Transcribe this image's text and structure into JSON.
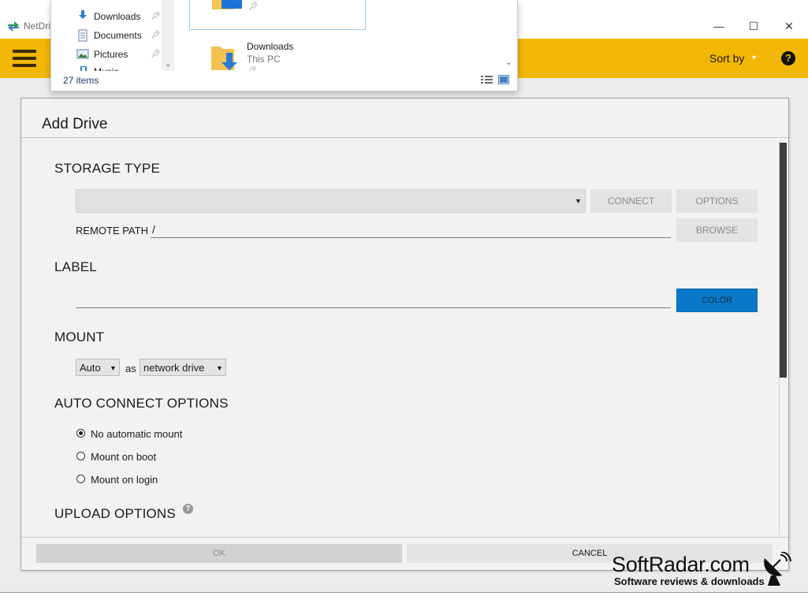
{
  "window": {
    "title": "NetDri",
    "min": "—",
    "max": "☐",
    "close": "✕"
  },
  "toolbar": {
    "sort_label": "Sort by",
    "sort_caret": "▾",
    "help": "?"
  },
  "explorer": {
    "nav_items": [
      {
        "label": "Downloads",
        "icon": "downloads-icon"
      },
      {
        "label": "Documents",
        "icon": "documents-icon"
      },
      {
        "label": "Pictures",
        "icon": "pictures-icon"
      },
      {
        "label": "Music",
        "icon": "music-icon"
      }
    ],
    "files": [
      {
        "name": "Downloads",
        "location": "This PC"
      }
    ],
    "item_count": "27 items"
  },
  "dialog": {
    "title": "Add Drive",
    "storage_type": {
      "heading": "STORAGE TYPE",
      "selected": "",
      "connect": "CONNECT",
      "options": "OPTIONS",
      "remote_path_label": "REMOTE PATH",
      "remote_path_value": "/",
      "browse": "BROWSE"
    },
    "label": {
      "heading": "LABEL",
      "value": "",
      "color": "COLOR"
    },
    "mount": {
      "heading": "MOUNT",
      "mode": "Auto",
      "as": "as",
      "type": "network drive"
    },
    "auto_connect": {
      "heading": "AUTO CONNECT OPTIONS",
      "options": [
        "No automatic mount",
        "Mount on boot",
        "Mount on login"
      ],
      "selected_index": 0
    },
    "upload": {
      "heading": "UPLOAD OPTIONS",
      "help": "?"
    },
    "ok": "OK",
    "cancel": "CANCEL"
  },
  "watermark": {
    "title": "SoftRadar.com",
    "subtitle": "Software reviews & downloads"
  },
  "colors": {
    "toolbar": "#f2b705",
    "accent_button": "#0a78c8"
  }
}
